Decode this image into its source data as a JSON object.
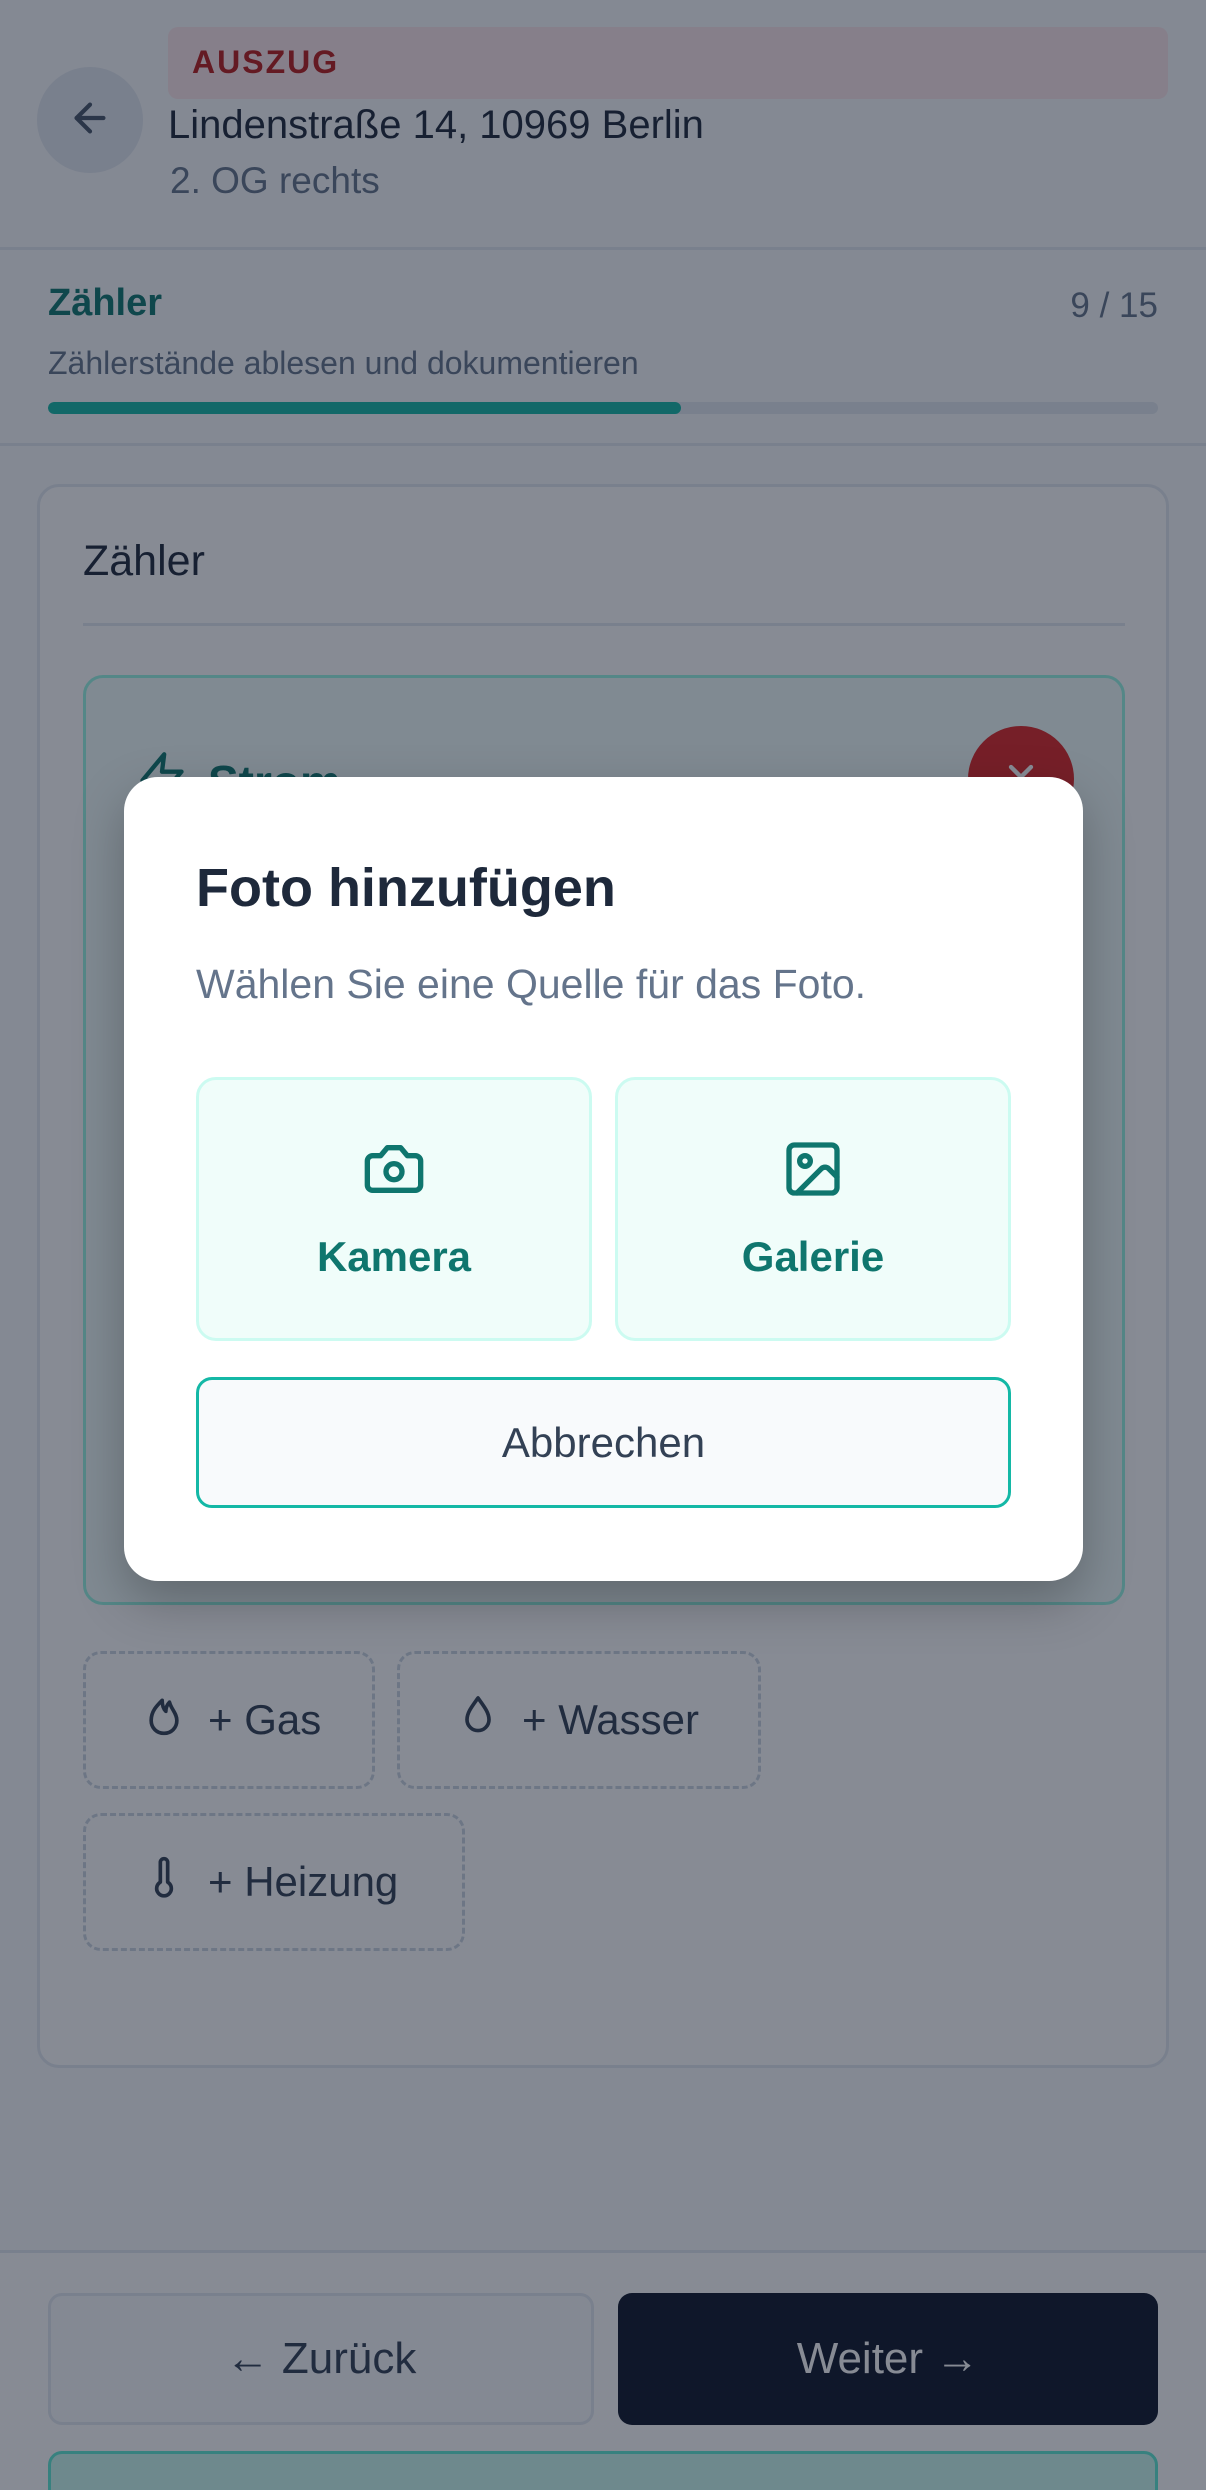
{
  "header": {
    "badge": "AUSZUG",
    "address": "Lindenstraße 14, 10969 Berlin",
    "address_sub": "2. OG rechts",
    "back_icon": "arrow-left-icon"
  },
  "progress": {
    "title": "Zähler",
    "count": "9 / 15",
    "description": "Zählerstände ablesen und dokumentieren",
    "fraction": 0.57
  },
  "card": {
    "title": "Zähler",
    "meter": {
      "name": "Strom",
      "icon": "lightning-icon",
      "remove_icon": "close-icon"
    },
    "add_buttons": {
      "gas": "+ Gas",
      "water": "+ Wasser",
      "heating": "+ Heizung"
    }
  },
  "footer": {
    "back_label": "← Zurück",
    "next_label": "Weiter →"
  },
  "modal": {
    "title": "Foto hinzufügen",
    "description": "Wählen Sie eine Quelle für das Foto.",
    "camera_label": "Kamera",
    "gallery_label": "Galerie",
    "cancel_label": "Abbrechen"
  },
  "colors": {
    "accent": "#0f766e",
    "accent_light": "#14b8a6",
    "danger": "#dc2626",
    "primary_dark": "#0f172a"
  }
}
